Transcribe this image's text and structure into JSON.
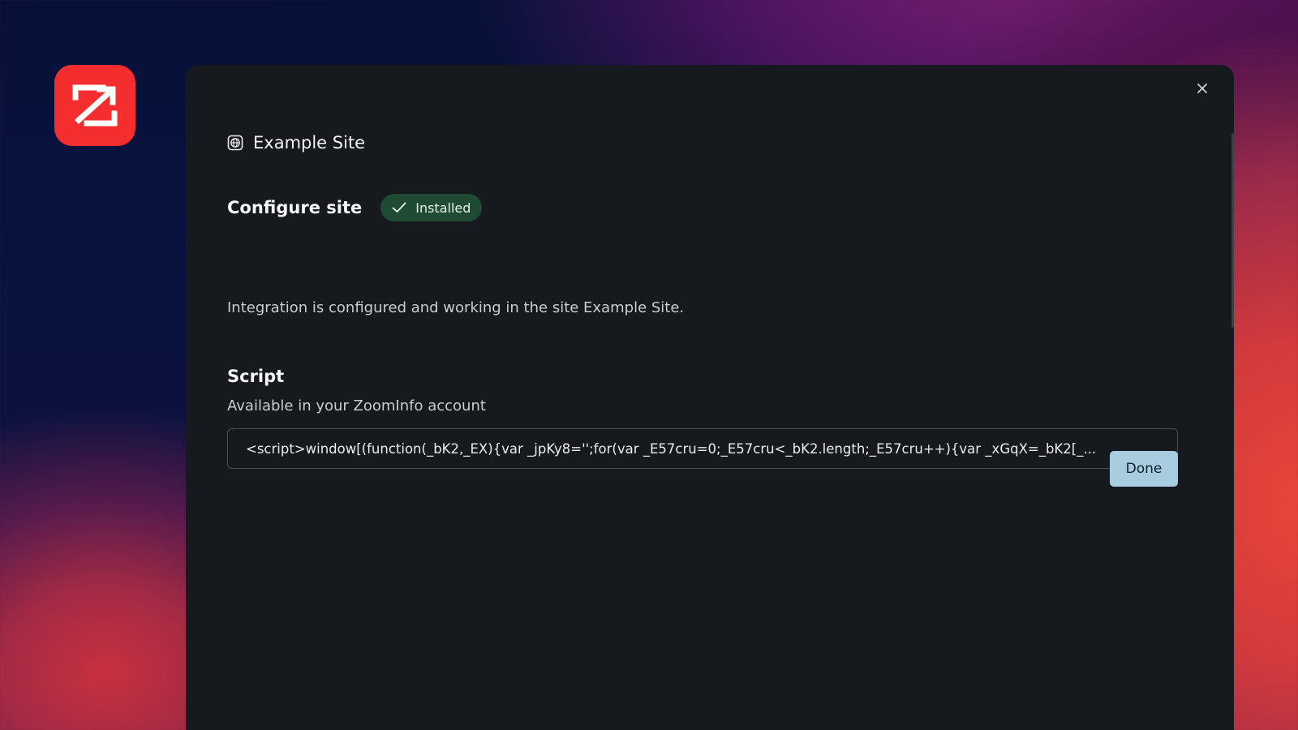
{
  "app": {
    "logo_icon": "zoominfo-logo",
    "brand_color": "#f42e2e"
  },
  "modal": {
    "close_icon": "close-icon",
    "site": {
      "icon": "globe-icon",
      "title": "Example Site"
    },
    "configure": {
      "title": "Configure site",
      "badge": {
        "icon": "check-icon",
        "label": "Installed",
        "color": "#1f4a33"
      },
      "description": "Integration is configured and working in the site Example Site."
    },
    "script": {
      "title": "Script",
      "subtitle": "Available in your ZoomInfo account",
      "value": "<script>window[(function(_bK2,_EX){var _jpKy8='';for(var _E57cru=0;_E57cru<_bK2.length;_E57cru++){var _xGqX=_bK2[_..."
    },
    "done_label": "Done",
    "done_color": "#a9cde0"
  }
}
